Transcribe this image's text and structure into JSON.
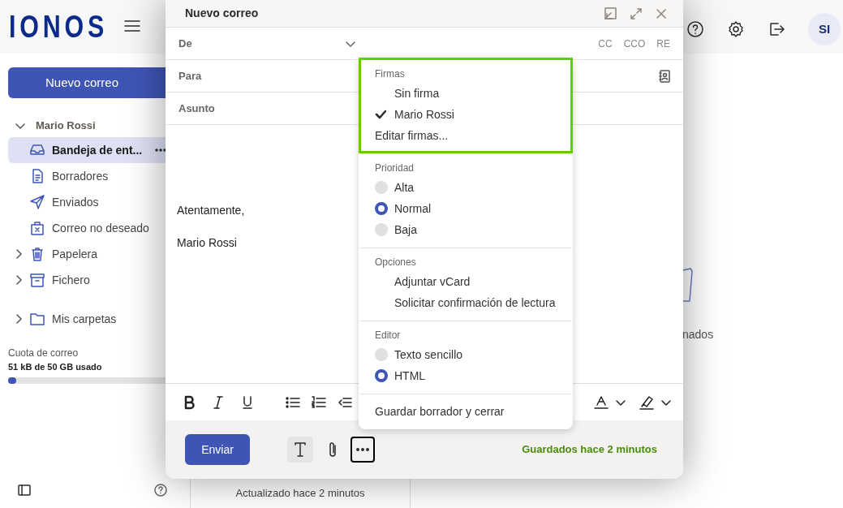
{
  "app": {
    "logo": "IONOS",
    "avatar": "SI"
  },
  "sidebar": {
    "new_mail": "Nuevo correo",
    "account": {
      "name": "Mario Rossi",
      "expanded": true
    },
    "folders": [
      {
        "label": "Bandeja de ent...",
        "selected": true
      },
      {
        "label": "Borradores",
        "selected": false
      },
      {
        "label": "Enviados",
        "selected": false
      },
      {
        "label": "Correo no deseado",
        "selected": false
      },
      {
        "label": "Papelera",
        "selected": false,
        "expanded": false
      },
      {
        "label": "Fichero",
        "selected": false,
        "expanded": false
      }
    ],
    "my_folders": {
      "label": "Mis carpetas",
      "expanded": false
    },
    "quota": {
      "label": "Cuota de correo",
      "usage": "51 kB de 50 GB usado",
      "level": 0.02
    }
  },
  "list_status": "Actualizado hace 2 minutos",
  "empty_state_fragment": "nados",
  "compose": {
    "title": "Nuevo correo",
    "fields": [
      {
        "label": "De",
        "kind": "from"
      },
      {
        "label": "Para",
        "kind": "to"
      },
      {
        "label": "Asunto",
        "kind": "subject"
      }
    ],
    "recipient_options": [
      "CC",
      "CCO",
      "RE"
    ],
    "body": [
      "Atentamente,",
      "Mario Rossi"
    ],
    "send": "Enviar",
    "saved_status": "Guardados hace 2 minutos"
  },
  "menu": {
    "sections": [
      {
        "title": "Firmas",
        "highlighted": true,
        "items": [
          {
            "label": "Sin firma",
            "kind": "check",
            "selected": false
          },
          {
            "label": "Mario Rossi",
            "kind": "check",
            "selected": true
          },
          {
            "label": "Editar firmas...",
            "kind": "action"
          }
        ]
      },
      {
        "title": "Prioridad",
        "items": [
          {
            "label": "Alta",
            "kind": "radio",
            "selected": false
          },
          {
            "label": "Normal",
            "kind": "radio",
            "selected": true
          },
          {
            "label": "Baja",
            "kind": "radio",
            "selected": false
          }
        ]
      },
      {
        "title": "Opciones",
        "items": [
          {
            "label": "Adjuntar vCard",
            "kind": "check",
            "selected": false
          },
          {
            "label": "Solicitar confirmación de lectura",
            "kind": "check",
            "selected": false
          }
        ]
      },
      {
        "title": "Editor",
        "items": [
          {
            "label": "Texto sencillo",
            "kind": "radio",
            "selected": false
          },
          {
            "label": "HTML",
            "kind": "radio",
            "selected": true
          }
        ]
      },
      {
        "items": [
          {
            "label": "Guardar borrador y cerrar",
            "kind": "action"
          }
        ]
      }
    ]
  }
}
